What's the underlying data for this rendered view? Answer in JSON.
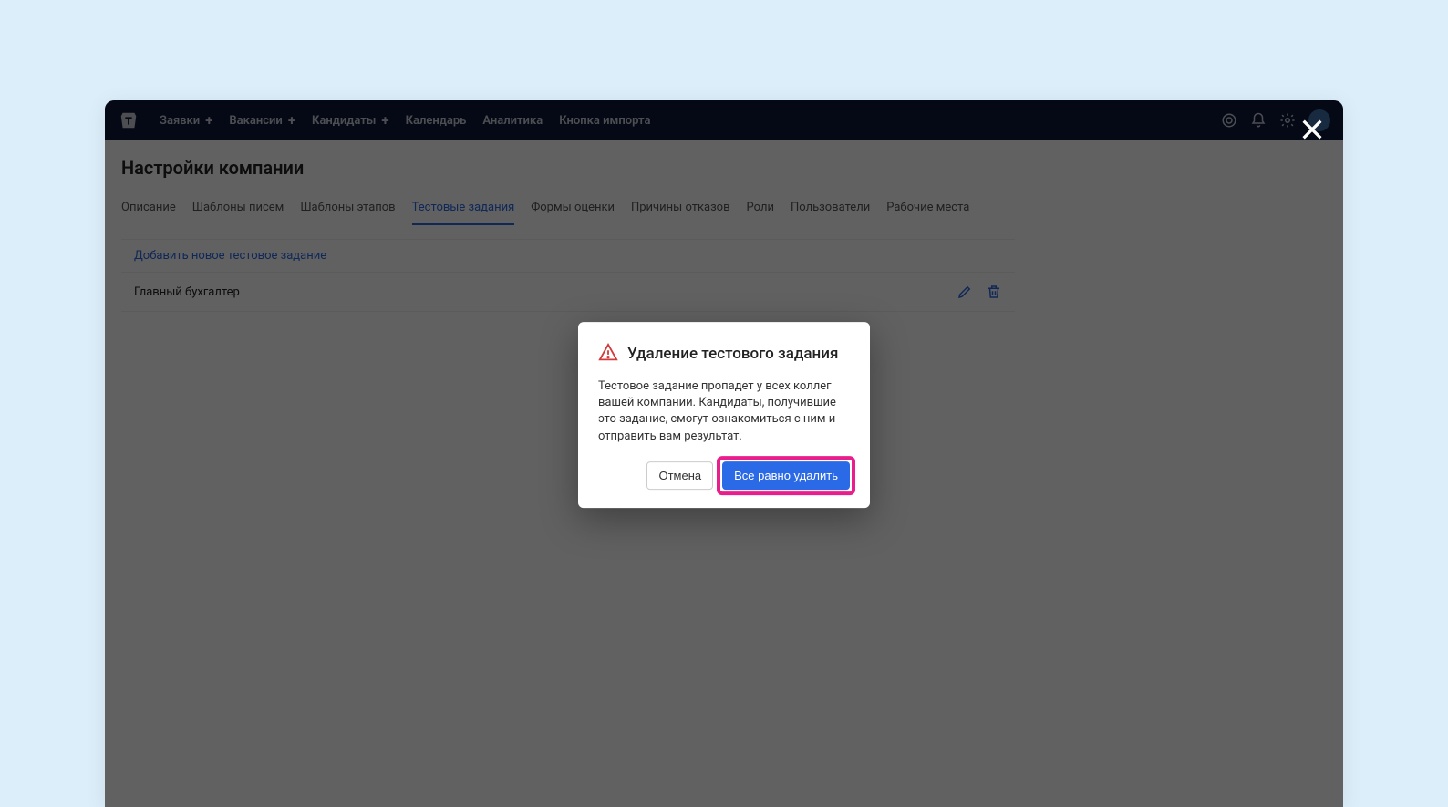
{
  "nav": {
    "items": [
      {
        "label": "Заявки",
        "plus": true
      },
      {
        "label": "Вакансии",
        "plus": true
      },
      {
        "label": "Кандидаты",
        "plus": true
      },
      {
        "label": "Календарь",
        "plus": false
      },
      {
        "label": "Аналитика",
        "plus": false
      },
      {
        "label": "Кнопка импорта",
        "plus": false
      }
    ],
    "plus_glyph": "+"
  },
  "page": {
    "title": "Настройки компании"
  },
  "tabs": [
    {
      "label": "Описание",
      "active": false
    },
    {
      "label": "Шаблоны писем",
      "active": false
    },
    {
      "label": "Шаблоны этапов",
      "active": false
    },
    {
      "label": "Тестовые задания",
      "active": true
    },
    {
      "label": "Формы оценки",
      "active": false
    },
    {
      "label": "Причины отказов",
      "active": false
    },
    {
      "label": "Роли",
      "active": false
    },
    {
      "label": "Пользователи",
      "active": false
    },
    {
      "label": "Рабочие места",
      "active": false
    }
  ],
  "add_link": "Добавить новое тестовое задание",
  "items": [
    {
      "name": "Главный бухгалтер"
    }
  ],
  "dialog": {
    "title": "Удаление тестового задания",
    "body": "Тестовое задание пропадет у всех коллег вашей компании. Кандидаты, получившие это задание, смогут ознакомиться с ним и отправить вам результат.",
    "cancel": "Отмена",
    "confirm": "Все равно удалить"
  },
  "colors": {
    "accent": "#2b6ae6",
    "highlight": "#e91e8c",
    "navbar": "#0e1a3a"
  }
}
